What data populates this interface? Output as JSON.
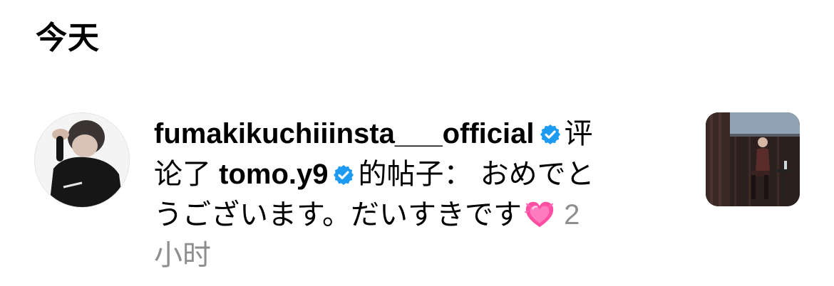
{
  "section": {
    "title": "今天"
  },
  "notification": {
    "actor": "fumakikuchiiinsta___official",
    "verb_part1": "评",
    "verb_part2": "论了",
    "target_user": "tomo.y9",
    "post_phrase": "的帖子：",
    "comment_part1": "おめでと",
    "comment_part2": "うございます。だいすきです",
    "emoji": "growing-heart",
    "time_part1": "2",
    "time_part2": "小时",
    "icons": {
      "actor_badge": "verified-badge-icon",
      "target_badge": "verified-badge-icon"
    },
    "colors": {
      "verified_blue": "#1d9bf0",
      "timestamp_gray": "#8e8e8e",
      "heart_pink": "#ff4fa3"
    }
  }
}
